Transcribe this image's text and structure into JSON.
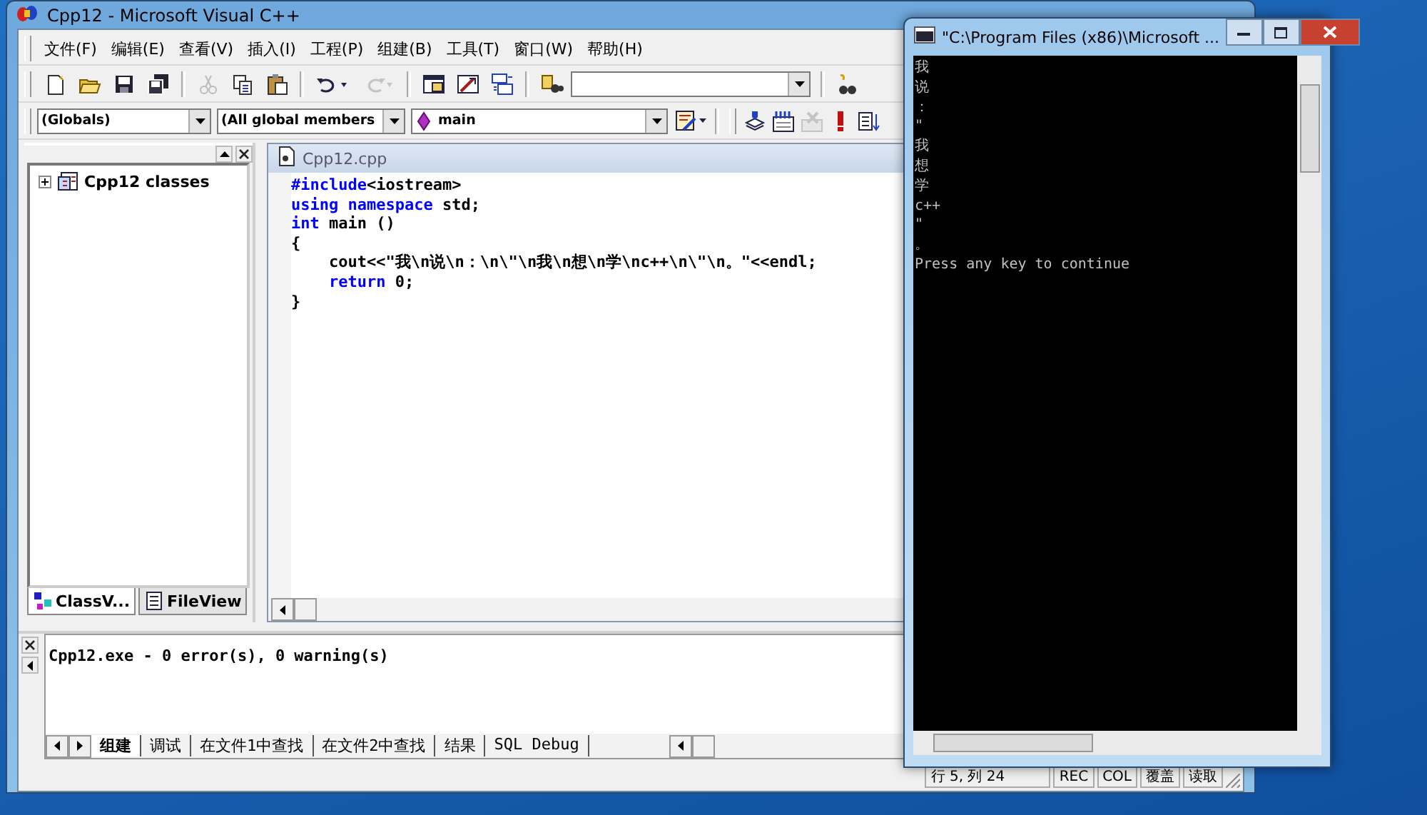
{
  "ide_window": {
    "title": "Cpp12 - Microsoft Visual C++"
  },
  "menu": [
    "文件(F)",
    "编辑(E)",
    "查看(V)",
    "插入(I)",
    "工程(P)",
    "组建(B)",
    "工具(T)",
    "窗口(W)",
    "帮助(H)"
  ],
  "standard_toolbar": [
    {
      "kind": "new",
      "disabled": false
    },
    {
      "kind": "open",
      "disabled": false
    },
    {
      "kind": "save",
      "disabled": false
    },
    {
      "kind": "saveall",
      "disabled": false
    },
    {
      "kind": "sep"
    },
    {
      "kind": "cut",
      "disabled": true
    },
    {
      "kind": "copy",
      "disabled": false
    },
    {
      "kind": "paste",
      "disabled": false
    },
    {
      "kind": "sep"
    },
    {
      "kind": "undo",
      "disabled": false
    },
    {
      "kind": "redo",
      "disabled": true
    },
    {
      "kind": "sep"
    },
    {
      "kind": "workspace",
      "disabled": false
    },
    {
      "kind": "output",
      "disabled": false
    },
    {
      "kind": "windows",
      "disabled": false
    },
    {
      "kind": "sep"
    },
    {
      "kind": "findfiles",
      "disabled": false
    },
    {
      "kind": "combo"
    },
    {
      "kind": "sep"
    },
    {
      "kind": "find",
      "disabled": false
    }
  ],
  "wizard_bar": {
    "class_combo": "(Globals)",
    "members_combo": "(All global members",
    "function_combo": "main"
  },
  "build_toolbar": [
    {
      "kind": "compile",
      "disabled": false
    },
    {
      "kind": "build",
      "disabled": false
    },
    {
      "kind": "stop",
      "disabled": true
    },
    {
      "kind": "execute",
      "disabled": false
    },
    {
      "kind": "breakpoint",
      "disabled": false
    }
  ],
  "workspace": {
    "tree": [
      {
        "label": "Cpp12 classes",
        "expanded": false
      }
    ],
    "tabs": [
      {
        "label": "ClassV...",
        "selected": true
      },
      {
        "label": "FileView",
        "selected": false
      }
    ]
  },
  "editor": {
    "title": "Cpp12.cpp",
    "lines": [
      {
        "indented": false,
        "segments": [
          {
            "kind": "keyword",
            "text": "#include"
          },
          {
            "kind": "plain",
            "text": "<iostream>"
          }
        ]
      },
      {
        "indented": false,
        "segments": [
          {
            "kind": "keyword",
            "text": "using namespace"
          },
          {
            "kind": "plain",
            "text": " std;"
          }
        ]
      },
      {
        "indented": false,
        "segments": [
          {
            "kind": "keyword",
            "text": "int"
          },
          {
            "kind": "plain",
            "text": " main ()"
          }
        ]
      },
      {
        "indented": false,
        "segments": [
          {
            "kind": "plain",
            "text": "{"
          }
        ]
      },
      {
        "indented": true,
        "segments": [
          {
            "kind": "plain",
            "text": "cout<<\"我\\n说\\n：\\n\\\"\\n我\\n想\\n学\\nc++\\n\\\"\\n。\"<<endl;"
          }
        ]
      },
      {
        "indented": true,
        "segments": [
          {
            "kind": "keyword",
            "text": "return"
          },
          {
            "kind": "plain",
            "text": " 0;"
          }
        ]
      },
      {
        "indented": false,
        "segments": [
          {
            "kind": "plain",
            "text": "}"
          }
        ]
      }
    ]
  },
  "output": {
    "lines": [
      "Cpp12.exe - 0 error(s), 0 warning(s)"
    ],
    "tabs": [
      {
        "label": "组建",
        "selected": true
      },
      {
        "label": "调试",
        "selected": false
      },
      {
        "label": "在文件1中查找",
        "selected": false
      },
      {
        "label": "在文件2中查找",
        "selected": false
      },
      {
        "label": "结果",
        "selected": false
      },
      {
        "label": "SQL Debug",
        "selected": false
      }
    ]
  },
  "status_bar": {
    "position": "行 5, 列 24",
    "indicators": [
      "REC",
      "COL",
      "覆盖",
      "读取"
    ]
  },
  "console_window": {
    "title": "\"C:\\Program Files (x86)\\Microsoft ...",
    "lines": [
      "我",
      "说",
      "：",
      "\"",
      "我",
      "想",
      "学",
      "c++",
      "\"",
      "。",
      "Press any key to continue"
    ]
  }
}
